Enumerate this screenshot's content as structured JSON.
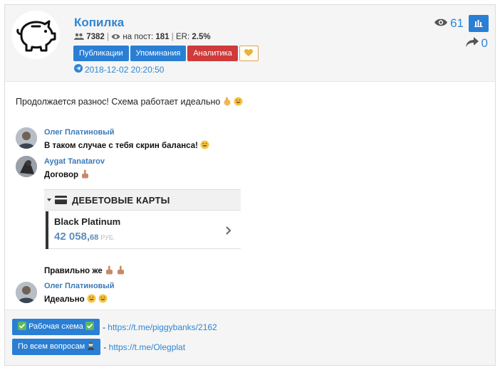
{
  "channel": {
    "title": "Копилка",
    "subscribers": "7382",
    "per_post_label": "на пост:",
    "per_post": "181",
    "er_label": "ER:",
    "er": "2.5%",
    "views": "61",
    "shares": "0",
    "date": "2018-12-02 20:20:50"
  },
  "buttons": {
    "publications": "Публикации",
    "mentions": "Упоминания",
    "analytics": "Аналитика"
  },
  "post": {
    "text": "Продолжается разнос! Схема работает идеально"
  },
  "messages": [
    {
      "author": "Олег Платиновый",
      "text": "В таком случае с тебя скрин баланса!"
    },
    {
      "author": "Aygat Tanatarov",
      "text": "Договор"
    },
    {
      "author": "",
      "text": "Правильно же"
    },
    {
      "author": "Олег Платиновый",
      "text": "Идеально"
    }
  ],
  "debit_card": {
    "header": "ДЕБЕТОВЫЕ КАРТЫ",
    "card_name": "Black Platinum",
    "amount": "42 058,",
    "cents": "68",
    "currency": "РУБ."
  },
  "footer": {
    "scheme_label": "Рабочая схема",
    "scheme_url": "https://t.me/piggybanks/2162",
    "questions_label": "По всем вопросам",
    "questions_url": "https://t.me/Olegplat",
    "dash": "-"
  },
  "colors": {
    "accent": "#2a7fd4",
    "link": "#2f86d3",
    "danger": "#cf3b3b"
  }
}
